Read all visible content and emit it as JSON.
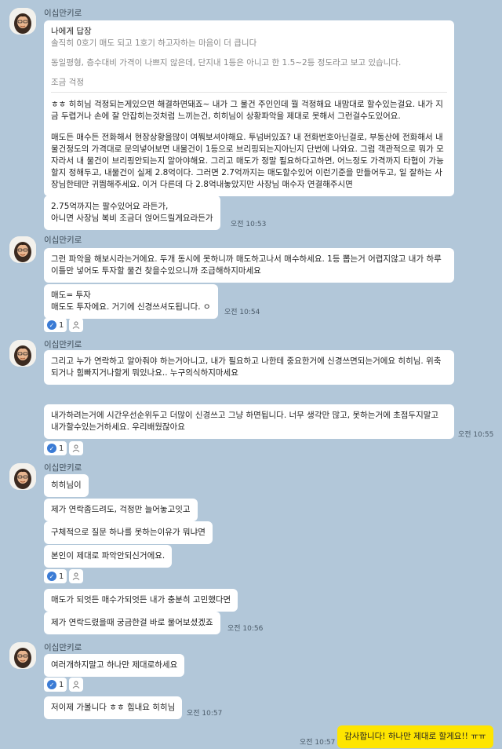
{
  "chat": {
    "groups": [
      {
        "sender": "이십만키로",
        "reply": {
          "header": "나에게 답장",
          "quote_lines": [
            "솔직히 0호기 매도 되고 1호기 하고자하는 마음이 더 큽니다",
            "동일평형, 층수대비 가격이 나쁘지 않은데, 단지내 1등은 아니고 한 1.5~2등 정도라고 보고 있습니다.",
            "조금 걱정"
          ],
          "body_paragraphs": [
            "ㅎㅎ 히히님 걱정되는게있으면 해결하면돼죠~ 내가 그 물건 주인인데 뭘 걱정해요 내맘대로 할수있는걸요. 내가 지금 두렵거나 손에 잘 안잡히는것처럼 느끼는건, 히히님이 상황파악을 제대로 못해서 그런걸수도있어요.",
            "매도든 매수든 전화해서 현장상황을많이 여쭤보셔야해요. 투넘버있죠? 내 전화번호아닌걸로, 부동산에 전화해서 내 물건정도의 가격대로 문의넣어보면 내물건이 1등으로 브리핑되는지아닌지 단번에 나와요. 그럼 객관적으로 뭐가 모자라서 내 물건이 브리핑안되는지 알아야해요. 그리고 매도가 정말 필요하다고하면, 어느정도 가격까지 타협이 가능할지 정해두고, 내물건이 실제 2.8억이다. 그러면 2.7억까지는 매도할수있어 이런기준을 만들어두고, 일 잘하는 사장님한테만 귀띔해주세요. 이거 다른데 다 2.8억내놓았지만 사장님 매수자 연결해주시면"
          ]
        },
        "messages": [
          "2.75억까지는 팔수있어요 라든가,\n아니면 사장님 복비 조금더 얹어드릴게요라든가"
        ],
        "time": "오전 10:53"
      },
      {
        "sender": "이십만키로",
        "messages": [
          "그런 파악을 해보시라는거에요. 두개 동시에 못하니까 매도하고나서 매수하세요. 1등 뽑는거 어렵지않고 내가 하루이틀만 넣어도 투자할 물건 찾을수있으니까 조급해하지마세요",
          "매도= 투자\n매도도 투자에요. 거기에 신경쓰셔도됩니다. ㅇ"
        ],
        "time": "오전 10:54",
        "reaction_count": "1"
      },
      {
        "sender": "이십만키로",
        "messages": [
          "그리고 누가 연락하고 알아줘야 하는거아니고, 내가 필요하고 나한테 중요한거에 신경쓰면되는거에요 히히님. 위축되거나 힘빠지거나할게 뭐있나요.. 누구의식하지마세요",
          "내가하려는거에 시간우선순위두고 더많이 신경쓰고 그냥 하면됩니다. 너무 생각만 많고, 못하는거에 초점두지말고 내가할수있는거하세요. 우리배웠잖아요"
        ],
        "time": "오전 10:55",
        "reaction_count": "1"
      },
      {
        "sender": "이십만키로",
        "messages_a": [
          "히히님이",
          "제가 연락좀드려도, 걱정만 늘어놓고잇고",
          "구체적으로 질문 하나를 못하는이유가 뭐냐면",
          "본인이 제대로 파악안되신거에요."
        ],
        "reaction_count_a": "1",
        "messages_b": [
          "매도가 되엇든 매수가되엇든 내가 충분히 고민했다면",
          "제가 연락드렸을때 궁금한걸 바로 물어보셨겠죠"
        ],
        "time": "오전 10:56"
      },
      {
        "sender": "이십만키로",
        "messages": [
          "여러개하지말고 하나만 제대로하세요"
        ],
        "reaction_count": "1",
        "messages_b": [
          "저이제 가볼니다 ㅎㅎ 힘내요 히히님"
        ],
        "time": "오전 10:57"
      }
    ],
    "my_message": {
      "text": "감사합니다! 하나만 제대로 할게요!! ㅠㅠ",
      "time": "오전 10:57"
    },
    "icons": {
      "avatar": "profile-avatar-icon",
      "check": "check-icon",
      "person": "person-icon"
    },
    "colors": {
      "background": "#b2c7d9",
      "my_bubble": "#fee500",
      "other_bubble": "#ffffff",
      "check": "#3a7bd5"
    }
  }
}
